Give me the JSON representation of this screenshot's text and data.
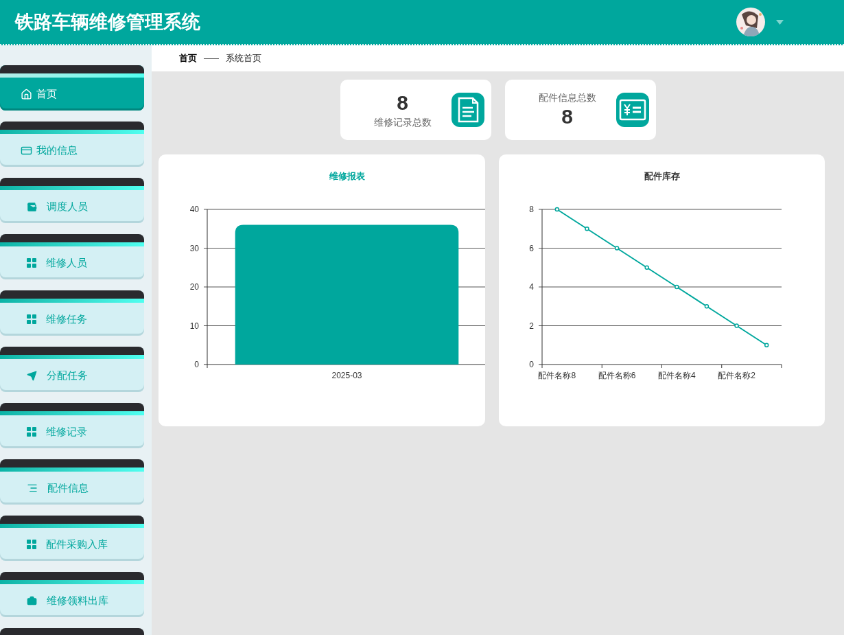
{
  "header": {
    "title": "铁路车辆维修管理系统"
  },
  "sidebar": {
    "items": [
      {
        "label": "首页",
        "selected": true
      },
      {
        "label": "我的信息",
        "selected": false
      },
      {
        "label": "调度人员",
        "selected": false
      },
      {
        "label": "维修人员",
        "selected": false
      },
      {
        "label": "维修任务",
        "selected": false
      },
      {
        "label": "分配任务",
        "selected": false
      },
      {
        "label": "维修记录",
        "selected": false
      },
      {
        "label": "配件信息",
        "selected": false
      },
      {
        "label": "配件采购入库",
        "selected": false
      },
      {
        "label": "维修领料出库",
        "selected": false
      }
    ]
  },
  "breadcrumb": [
    "首页",
    "系统首页"
  ],
  "stats": [
    {
      "kind": "value-first",
      "value": "8",
      "label": "维修记录总数"
    },
    {
      "kind": "label-first",
      "label": "配件信息总数",
      "value": "8"
    }
  ],
  "charts": [
    {
      "chart_data": {
        "type": "bar",
        "title": "维修报表",
        "categories": [
          "2025-03"
        ],
        "values": [
          36
        ],
        "ylim": [
          0,
          40
        ],
        "yticks": [
          0,
          10,
          20,
          30,
          40
        ],
        "grid": true
      }
    },
    {
      "chart_data": {
        "type": "line",
        "title": "配件库存",
        "categories": [
          "配件名称8",
          null,
          "配件名称6",
          null,
          "配件名称4",
          null,
          "配件名称2",
          null
        ],
        "values": [
          8,
          7,
          6,
          5,
          4,
          3,
          2,
          1
        ],
        "ylim": [
          0,
          8
        ],
        "yticks": [
          0,
          2,
          4,
          6,
          8
        ],
        "grid": true,
        "marker": "circle"
      }
    }
  ]
}
